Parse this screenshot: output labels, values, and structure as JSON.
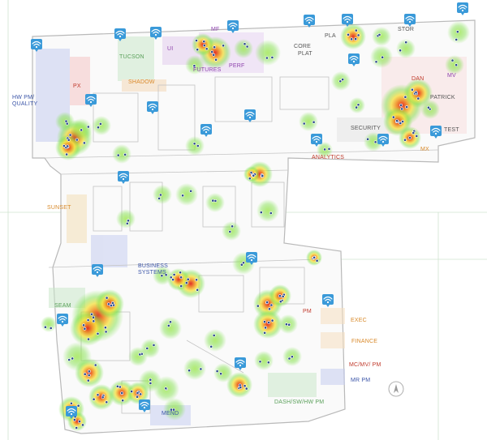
{
  "map": {
    "labels": [
      {
        "key": "hw_pm_1",
        "text": "HW PM/",
        "color": "#3b55a8"
      },
      {
        "key": "hw_pm_2",
        "text": "QUALITY",
        "color": "#3b55a8"
      },
      {
        "key": "px",
        "text": "PX",
        "color": "#c0392b"
      },
      {
        "key": "tucson",
        "text": "TUCSON",
        "color": "#5aa05a"
      },
      {
        "key": "shadow",
        "text": "SHADOW",
        "color": "#d98a2b"
      },
      {
        "key": "ui",
        "text": "UI",
        "color": "#8e44ad"
      },
      {
        "key": "mf",
        "text": "MF",
        "color": "#8e44ad"
      },
      {
        "key": "futures",
        "text": "FUTURES",
        "color": "#8e44ad"
      },
      {
        "key": "perf",
        "text": "PERF",
        "color": "#8e44ad"
      },
      {
        "key": "core",
        "text": "CORE",
        "color": "#555555"
      },
      {
        "key": "plat",
        "text": "PLAT",
        "color": "#555555"
      },
      {
        "key": "pla",
        "text": "PLA",
        "color": "#555555"
      },
      {
        "key": "stor",
        "text": "STOR",
        "color": "#555555"
      },
      {
        "key": "dan",
        "text": "DAN",
        "color": "#c0392b"
      },
      {
        "key": "mv",
        "text": "MV",
        "color": "#8e44ad"
      },
      {
        "key": "patrick",
        "text": "PATRICK",
        "color": "#555555"
      },
      {
        "key": "test",
        "text": "TEST",
        "color": "#555555"
      },
      {
        "key": "security",
        "text": "SECURITY",
        "color": "#555555"
      },
      {
        "key": "mx",
        "text": "MX",
        "color": "#d98a2b"
      },
      {
        "key": "analytics",
        "text": "ANALYTICS",
        "color": "#c0392b"
      },
      {
        "key": "sunset",
        "text": "SUNSET",
        "color": "#d98a2b"
      },
      {
        "key": "business_1",
        "text": "BUSINESS",
        "color": "#3b55a8"
      },
      {
        "key": "business_2",
        "text": "SYSTEMS",
        "color": "#3b55a8"
      },
      {
        "key": "seam",
        "text": "SEAM",
        "color": "#5aa05a"
      },
      {
        "key": "pm",
        "text": "PM",
        "color": "#c0392b"
      },
      {
        "key": "exec",
        "text": "EXEC",
        "color": "#d98a2b"
      },
      {
        "key": "finance",
        "text": "FINANCE",
        "color": "#d98a2b"
      },
      {
        "key": "mcmvpm",
        "text": "MC/MV/ PM",
        "color": "#c0392b"
      },
      {
        "key": "mrpm",
        "text": "MR PM",
        "color": "#3b55a8"
      },
      {
        "key": "dash",
        "text": "DASH/SW/HW PM",
        "color": "#5aa05a"
      },
      {
        "key": "mend",
        "text": "MEND",
        "color": "#3b55a8"
      }
    ],
    "access_point_count": 24,
    "colors": {
      "access_point": "#3a9ad9",
      "heat_low": "#7fe04a",
      "heat_mid": "#f6e23c",
      "heat_high": "#f08a24",
      "heat_peak": "#e0231d",
      "client_dot": "#2c4a8a",
      "walls": "#b9b9b9"
    }
  }
}
